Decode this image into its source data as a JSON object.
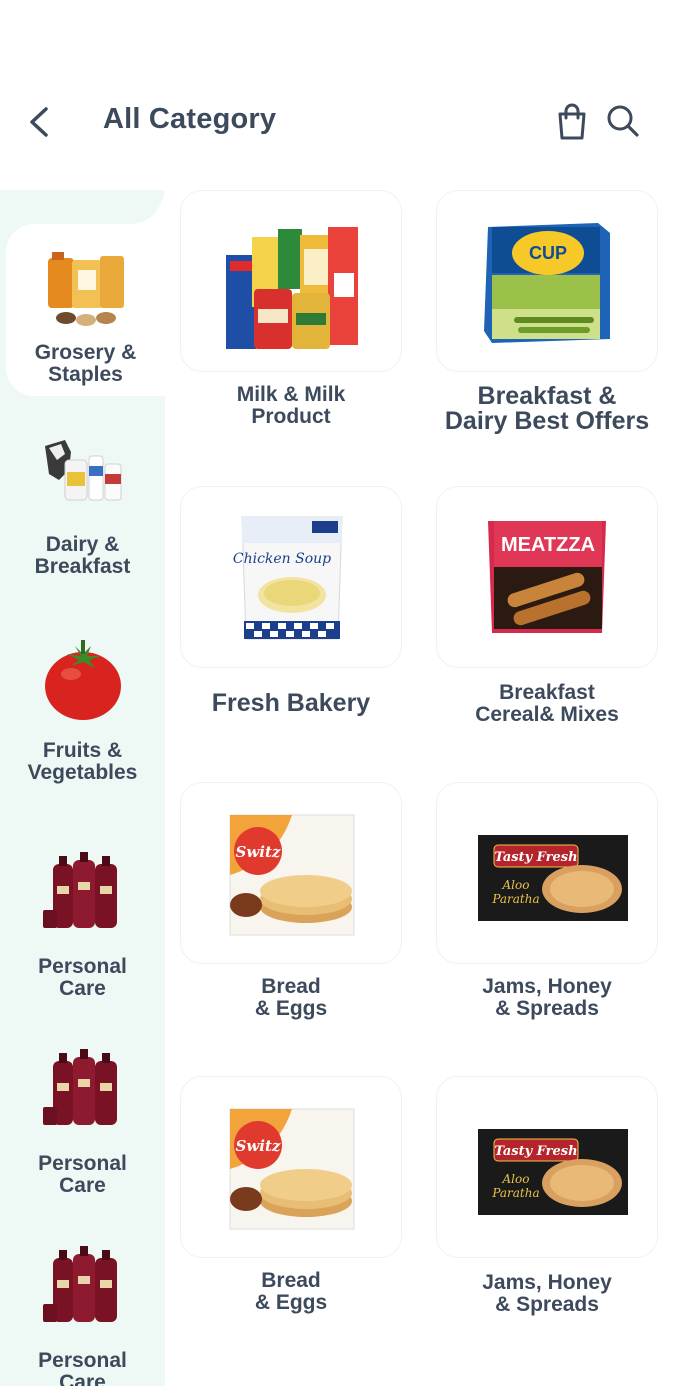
{
  "header": {
    "title": "All Category"
  },
  "icons": {
    "back": "chevron-left-icon",
    "cart": "shopping-bag-icon",
    "search": "search-icon"
  },
  "colors": {
    "text": "#3d4a5c",
    "sidebar_bg": "#eef8f4",
    "card_border": "#f1f1f1"
  },
  "sidebar": {
    "items": [
      {
        "label": "Grosery &\nStaples",
        "active": true
      },
      {
        "label": "Dairy &\nBreakfast",
        "active": false
      },
      {
        "label": "Fruits &\nVegetables",
        "active": false
      },
      {
        "label": "Personal\nCare",
        "active": false
      },
      {
        "label": "Personal\nCare",
        "active": false
      },
      {
        "label": "Personal\nCare",
        "active": false
      }
    ]
  },
  "categories": [
    {
      "label": "Milk & Milk\nProduct"
    },
    {
      "label": "Breakfast &\nDairy Best Offers"
    },
    {
      "label": "Fresh Bakery"
    },
    {
      "label": "Breakfast\nCereal& Mixes"
    },
    {
      "label": "Bread\n& Eggs"
    },
    {
      "label": "Jams, Honey\n& Spreads"
    },
    {
      "label": "Bread\n& Eggs"
    },
    {
      "label": "Jams, Honey\n& Spreads"
    }
  ]
}
